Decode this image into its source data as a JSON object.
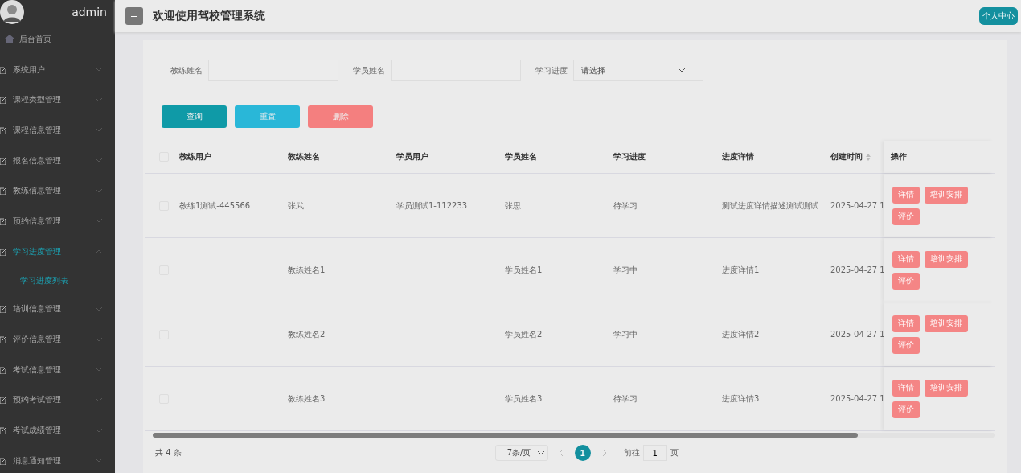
{
  "sidebar": {
    "username": "admin",
    "items": [
      {
        "kind": "home",
        "label": "后台首页",
        "expanded": false
      },
      {
        "kind": "group",
        "label": "系统用户",
        "expanded": false
      },
      {
        "kind": "group",
        "label": "课程类型管理",
        "expanded": false
      },
      {
        "kind": "group",
        "label": "课程信息管理",
        "expanded": false
      },
      {
        "kind": "group",
        "label": "报名信息管理",
        "expanded": false
      },
      {
        "kind": "group",
        "label": "教练信息管理",
        "expanded": false
      },
      {
        "kind": "group",
        "label": "预约信息管理",
        "expanded": false
      },
      {
        "kind": "group",
        "label": "学习进度管理",
        "expanded": true,
        "children": [
          {
            "label": "学习进度列表",
            "selected": true
          }
        ]
      },
      {
        "kind": "group",
        "label": "培训信息管理",
        "expanded": false
      },
      {
        "kind": "group",
        "label": "评价信息管理",
        "expanded": false
      },
      {
        "kind": "group",
        "label": "考试信息管理",
        "expanded": false
      },
      {
        "kind": "group",
        "label": "预约考试管理",
        "expanded": false
      },
      {
        "kind": "group",
        "label": "考试成绩管理",
        "expanded": false
      },
      {
        "kind": "group",
        "label": "消息通知管理",
        "expanded": false
      }
    ]
  },
  "header": {
    "title": "欢迎使用驾校管理系统",
    "profile_button": "个人中心"
  },
  "filters": [
    {
      "kind": "input",
      "label": "教练姓名"
    },
    {
      "kind": "input",
      "label": "学员姓名"
    },
    {
      "kind": "select",
      "label": "学习进度",
      "placeholder": "请选择"
    }
  ],
  "buttons": [
    {
      "kind": "query",
      "label": "查询"
    },
    {
      "kind": "reset",
      "label": "重置"
    },
    {
      "kind": "delete",
      "label": "删除"
    }
  ],
  "table": {
    "select_all_checked": false,
    "columns": [
      {
        "label": "教练用户",
        "sortable": false
      },
      {
        "label": "教练姓名",
        "sortable": false
      },
      {
        "label": "学员用户",
        "sortable": false
      },
      {
        "label": "学员姓名",
        "sortable": false
      },
      {
        "label": "学习进度",
        "sortable": false
      },
      {
        "label": "进度详情",
        "sortable": false
      },
      {
        "label": "创建时间",
        "sortable": true
      },
      {
        "label": "操作",
        "sortable": false
      }
    ],
    "rows": [
      {
        "checked": false,
        "cells": [
          "教练1测试-445566",
          "张武",
          "学员测试1-112233",
          "张思",
          "待学习",
          "测试进度详情描述测试测试",
          "2025-04-27 1"
        ],
        "actions": [
          "详情",
          "培训安排",
          "评价"
        ]
      },
      {
        "checked": false,
        "cells": [
          "",
          "教练姓名1",
          "",
          "学员姓名1",
          "学习中",
          "进度详情1",
          "2025-04-27 1"
        ],
        "actions": [
          "详情",
          "培训安排",
          "评价"
        ]
      },
      {
        "checked": false,
        "cells": [
          "",
          "教练姓名2",
          "",
          "学员姓名2",
          "学习中",
          "进度详情2",
          "2025-04-27 1"
        ],
        "actions": [
          "详情",
          "培训安排",
          "评价"
        ]
      },
      {
        "checked": false,
        "cells": [
          "",
          "教练姓名3",
          "",
          "学员姓名3",
          "待学习",
          "进度详情3",
          "2025-04-27 1"
        ],
        "actions": [
          "详情",
          "培训安排",
          "评价"
        ]
      }
    ]
  },
  "pagination": {
    "total": "共 4 条",
    "page_size": "7条/页",
    "pages": [
      {
        "label": "1",
        "selected": true
      }
    ],
    "goto_label": "前往",
    "goto_value": "1",
    "page_suffix": "页"
  }
}
